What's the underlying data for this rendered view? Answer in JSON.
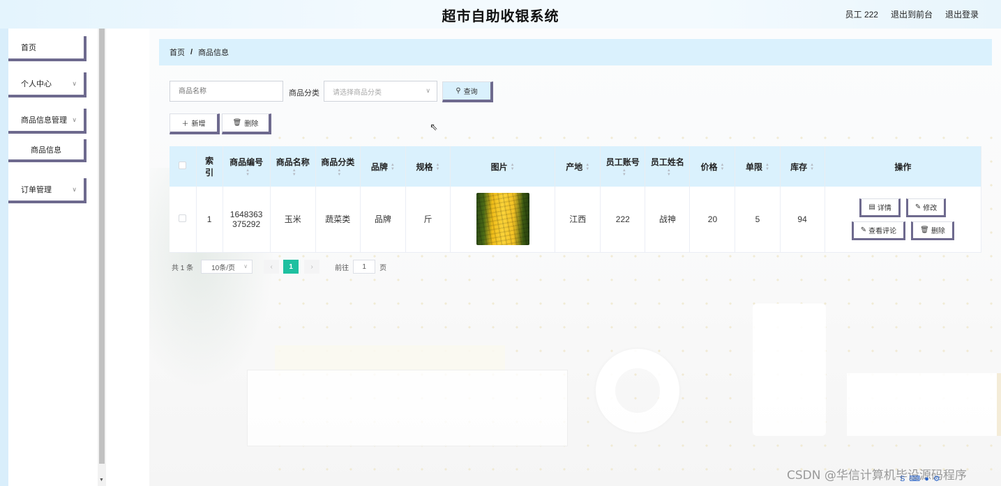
{
  "header": {
    "title": "超市自助收银系统",
    "user": "员工 222",
    "back_to_front": "退出到前台",
    "logout": "退出登录"
  },
  "sidebar": {
    "items": [
      {
        "label": "首页"
      },
      {
        "label": "个人中心"
      },
      {
        "label": "商品信息管理"
      },
      {
        "label": "商品信息"
      },
      {
        "label": "订单管理"
      }
    ]
  },
  "breadcrumb": {
    "home": "首页",
    "sep": "/",
    "current": "商品信息"
  },
  "search": {
    "name_placeholder": "商品名称",
    "category_label": "商品分类",
    "category_placeholder": "请选择商品分类",
    "query_button": "查询"
  },
  "toolbar": {
    "add_label": "新增",
    "delete_label": "删除"
  },
  "table": {
    "headers": [
      "索引",
      "商品编号",
      "商品名称",
      "商品分类",
      "品牌",
      "规格",
      "图片",
      "产地",
      "员工账号",
      "员工姓名",
      "价格",
      "单限",
      "库存",
      "操作"
    ],
    "header_index_line1": "索",
    "header_index_line2": "引",
    "rows": [
      {
        "index": "1",
        "code_line1": "1648363",
        "code_line2": "375292",
        "name": "玉米",
        "category": "蔬菜类",
        "brand": "品牌",
        "spec": "斤",
        "image": "corn",
        "origin": "江西",
        "staff_account": "222",
        "staff_name": "战神",
        "price": "20",
        "limit": "5",
        "stock": "94",
        "actions": {
          "detail": "详情",
          "edit": "修改",
          "comments": "查看评论",
          "delete": "删除"
        }
      }
    ]
  },
  "pagination": {
    "total": "共 1 条",
    "page_size": "10条/页",
    "current_page": "1",
    "goto_label": "前往",
    "goto_value": "1",
    "page_unit": "页"
  },
  "watermark": "CSDN @华信计算机毕设源码程序",
  "colors": {
    "accent": "#6e6a8e",
    "header_bg": "#daf1fd",
    "page_current": "#1ec0a0"
  }
}
